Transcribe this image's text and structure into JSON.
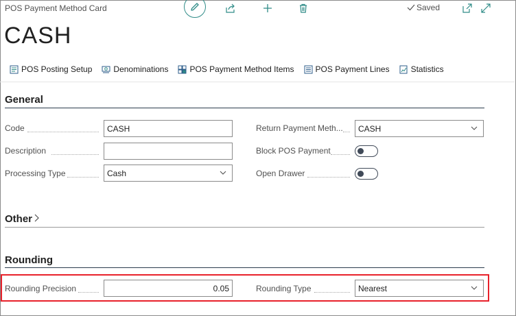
{
  "header": {
    "card_title": "POS Payment Method Card",
    "saved_label": "Saved"
  },
  "page": {
    "title": "CASH"
  },
  "actions": [
    {
      "label": "POS Posting Setup",
      "icon": "posting-setup-icon"
    },
    {
      "label": "Denominations",
      "icon": "denominations-icon"
    },
    {
      "label": "POS Payment Method Items",
      "icon": "items-icon"
    },
    {
      "label": "POS Payment Lines",
      "icon": "lines-icon"
    },
    {
      "label": "Statistics",
      "icon": "statistics-icon"
    }
  ],
  "general": {
    "title": "General",
    "code_label": "Code",
    "code_value": "CASH",
    "description_label": "Description",
    "description_value": "",
    "processing_type_label": "Processing Type",
    "processing_type_value": "Cash",
    "return_payment_label": "Return Payment Meth...",
    "return_payment_value": "CASH",
    "block_pos_label": "Block POS Payment",
    "block_pos_value": false,
    "open_drawer_label": "Open Drawer",
    "open_drawer_value": false
  },
  "other": {
    "title": "Other"
  },
  "rounding": {
    "title": "Rounding",
    "precision_label": "Rounding Precision",
    "precision_value": "0.05",
    "type_label": "Rounding Type",
    "type_value": "Nearest"
  },
  "colors": {
    "accent": "#2e8b87",
    "highlight": "#e8202a"
  }
}
